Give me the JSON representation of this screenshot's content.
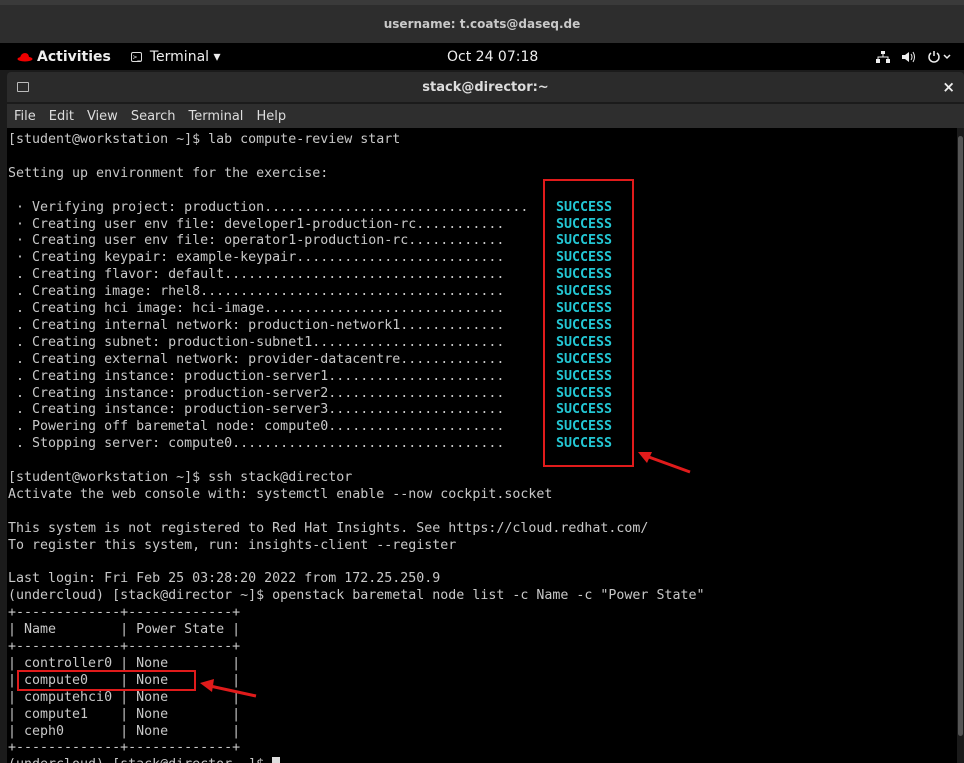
{
  "userbar": {
    "text": "username: t.coats@daseq.de"
  },
  "topbar": {
    "activities": "Activities",
    "app_menu": "Terminal ▾",
    "clock": "Oct 24  07:18",
    "network_icon": "network-icon",
    "volume_icon": "volume-icon",
    "power_icon": "power-icon"
  },
  "window": {
    "title": "stack@director:~",
    "close": "×",
    "menu": [
      "File",
      "Edit",
      "View",
      "Search",
      "Terminal",
      "Help"
    ]
  },
  "terminal": {
    "success_label": "SUCCESS",
    "lines": [
      "[student@workstation ~]$ lab compute-review start",
      "",
      "Setting up environment for the exercise:",
      "",
      " · Verifying project: production.................................",
      " · Creating user env file: developer1-production-rc...........",
      " · Creating user env file: operator1-production-rc............",
      " · Creating keypair: example-keypair..........................",
      " . Creating flavor: default...................................",
      " . Creating image: rhel8......................................",
      " . Creating hci image: hci-image..............................",
      " . Creating internal network: production-network1.............",
      " . Creating subnet: production-subnet1........................",
      " . Creating external network: provider-datacentre.............",
      " . Creating instance: production-server1......................",
      " . Creating instance: production-server2......................",
      " . Creating instance: production-server3......................",
      " . Powering off baremetal node: compute0......................",
      " . Stopping server: compute0..................................",
      "",
      "[student@workstation ~]$ ssh stack@director",
      "Activate the web console with: systemctl enable --now cockpit.socket",
      "",
      "This system is not registered to Red Hat Insights. See https://cloud.redhat.com/",
      "To register this system, run: insights-client --register",
      "",
      "Last login: Fri Feb 25 03:28:20 2022 from 172.25.250.9",
      "(undercloud) [stack@director ~]$ openstack baremetal node list -c Name -c \"Power State\"",
      "+-------------+-------------+",
      "| Name        | Power State |",
      "+-------------+-------------+",
      "| controller0 | None        |",
      "| compute0    | None        |",
      "| computehci0 | None        |",
      "| compute1    | None        |",
      "| ceph0       | None        |",
      "+-------------+-------------+",
      "(undercloud) [stack@director ~]$ "
    ]
  },
  "colors": {
    "success": "#23c7d4",
    "highlight": "#e01b1b",
    "terminal_bg": "#000000"
  }
}
